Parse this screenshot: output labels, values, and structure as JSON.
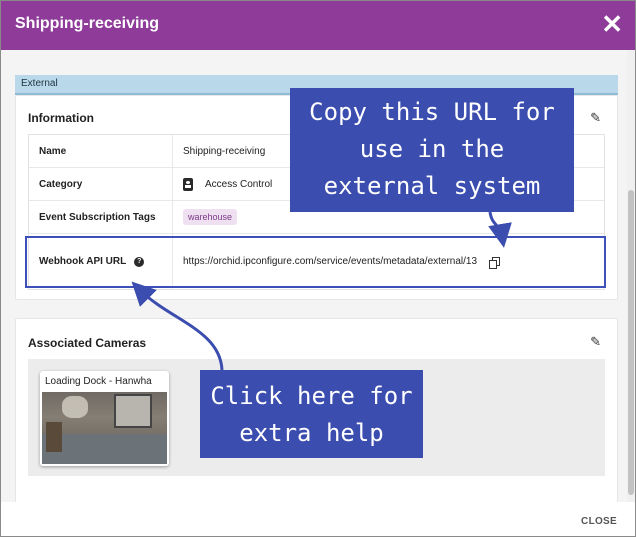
{
  "dialog": {
    "title": "Shipping-receiving",
    "close_icon_glyph": "✕",
    "accent_color": "#8e3b99"
  },
  "section": {
    "label": "External"
  },
  "information": {
    "title": "Information",
    "edit_icon_glyph": "✎",
    "rows": [
      {
        "label": "Name",
        "value": "Shipping-receiving"
      },
      {
        "label": "Category",
        "value": "Access Control",
        "icon": "badge-icon"
      },
      {
        "label": "Event Subscription Tags",
        "tag": "warehouse"
      },
      {
        "label": "Webhook API URL",
        "help_glyph": "?",
        "value": "https://orchid.ipconfigure.com/service/events/metadata/external/13",
        "icon": "copy-icon"
      }
    ]
  },
  "cameras": {
    "title": "Associated Cameras",
    "edit_icon_glyph": "✎",
    "items": [
      {
        "label": "Loading Dock - Hanwha"
      }
    ]
  },
  "footer": {
    "close_label": "CLOSE"
  },
  "annotations": {
    "top_callout": [
      "Copy this URL for",
      "use in the",
      "external system"
    ],
    "bottom_callout": [
      "Click here for",
      "extra help"
    ],
    "callout_color": "#3b4dae"
  }
}
